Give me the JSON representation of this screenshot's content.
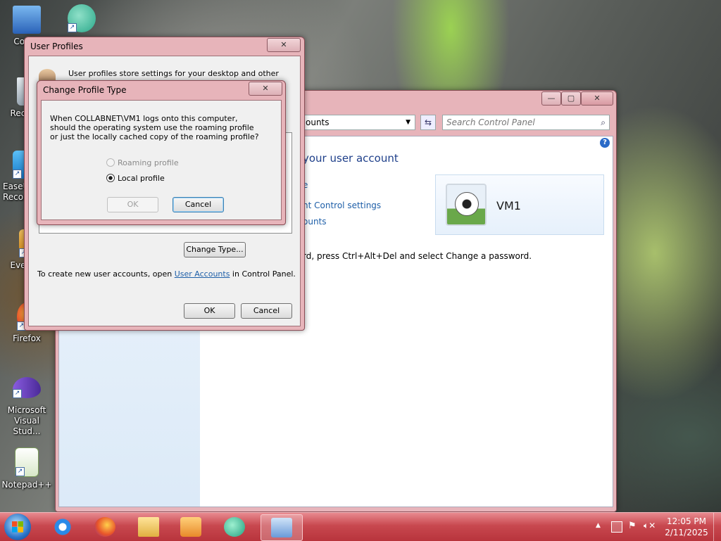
{
  "desktop": {
    "icons": [
      {
        "label": "Con",
        "color": "#3a78c8"
      },
      {
        "label": "",
        "color": "#2aa88a"
      },
      {
        "label": "Recy",
        "color": "#b8c4cc"
      },
      {
        "label": "EaseU Reco",
        "color": "#1e8fd8"
      },
      {
        "label": "Ever",
        "color": "#e8a020"
      },
      {
        "label": "Firefox",
        "color": "#e8542a"
      },
      {
        "label": "Microsoft Visual Stud...",
        "color": "#6a3cb8"
      },
      {
        "label": "Notepad++",
        "color": "#8cc63f"
      }
    ]
  },
  "control_panel": {
    "address_text": "ounts",
    "search_placeholder": "Search Control Panel",
    "heading": "your user account",
    "links": [
      "e",
      "nt Control settings",
      "ounts"
    ],
    "password_hint": "rd, press Ctrl+Alt+Del and select Change a password.",
    "user_name": "VM1",
    "title_buttons": {
      "minimize": "—",
      "maximize": "▢",
      "close": "✕"
    }
  },
  "user_profiles": {
    "title": "User Profiles",
    "description_line1": "User profiles store settings for your desktop and other",
    "change_type_button": "Change Type...",
    "create_text_prefix": "To create new user accounts, open ",
    "create_link": "User Accounts",
    "create_text_suffix": " in Control Panel.",
    "ok_button": "OK",
    "cancel_button": "Cancel",
    "close_glyph": "✕"
  },
  "change_profile_type": {
    "title": "Change Profile Type",
    "message": "When COLLABNET\\VM1 logs onto this computer, should the operating system use the roaming profile or just the locally cached copy of the roaming profile?",
    "options": [
      {
        "label": "Roaming profile",
        "selected": false,
        "enabled": false
      },
      {
        "label": "Local profile",
        "selected": true,
        "enabled": true
      }
    ],
    "ok_button": "OK",
    "cancel_button": "Cancel",
    "close_glyph": "✕"
  },
  "taskbar": {
    "start_icon": "windows-start-icon",
    "pinned": [
      "internet-explorer-icon",
      "firefox-icon",
      "file-explorer-icon",
      "media-player-icon",
      "app-bubble-icon",
      "control-panel-icon"
    ],
    "time": "12:05 PM",
    "date": "2/11/2025",
    "tray_expand": "▲"
  }
}
